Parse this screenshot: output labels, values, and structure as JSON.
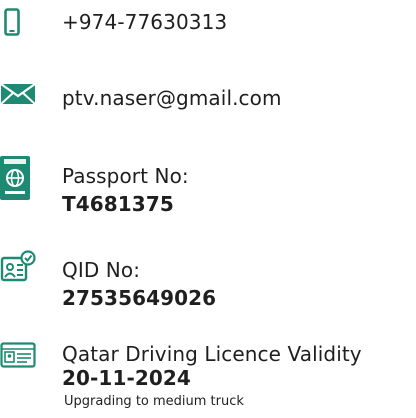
{
  "colors": {
    "accent": "#1e8a73",
    "text": "#1f1f1f"
  },
  "contact": {
    "phone": {
      "icon": "phone-icon",
      "value": "+974-77630313"
    },
    "email": {
      "icon": "mail-icon",
      "value": "ptv.naser@gmail.com"
    }
  },
  "documents": [
    {
      "icon": "passport-icon",
      "label": "Passport No:",
      "value": "T4681375"
    },
    {
      "icon": "id-card-icon",
      "label": "QID No:",
      "value": "27535649026"
    },
    {
      "icon": "driving-licence-icon",
      "label": "Qatar Driving Licence Validity",
      "value": "20-11-2024",
      "note": "Upgrading to medium truck"
    }
  ]
}
